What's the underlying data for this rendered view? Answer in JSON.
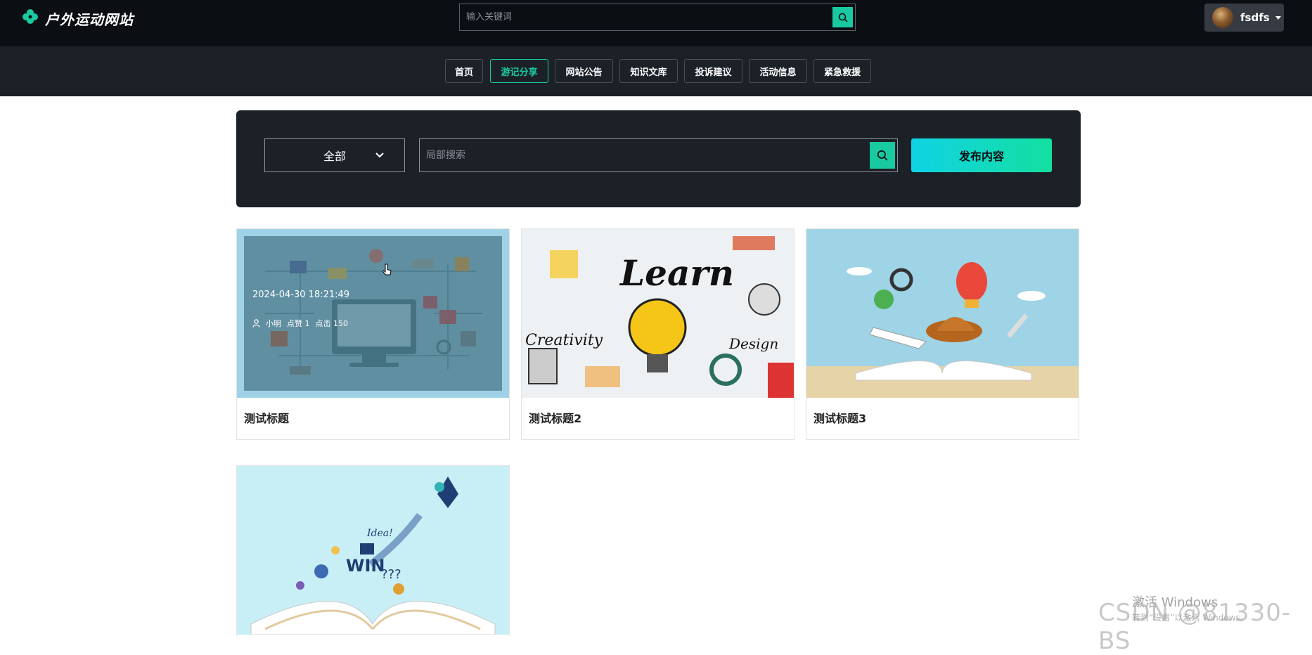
{
  "header": {
    "site_title": "户外运动网站",
    "search_placeholder": "输入关键词",
    "username": "fsdfs"
  },
  "nav": {
    "items": [
      {
        "label": "首页",
        "active": false
      },
      {
        "label": "游记分享",
        "active": true
      },
      {
        "label": "网站公告",
        "active": false
      },
      {
        "label": "知识文库",
        "active": false
      },
      {
        "label": "投诉建议",
        "active": false
      },
      {
        "label": "活动信息",
        "active": false
      },
      {
        "label": "紧急救援",
        "active": false
      }
    ]
  },
  "filter": {
    "category_selected": "全部",
    "search_placeholder": "局部搜索",
    "publish_label": "发布内容"
  },
  "cards": [
    {
      "title": "测试标题",
      "date": "2024-04-30 18:21:49",
      "author": "小明",
      "likes": "点赞 1",
      "views": "点击 150",
      "image": "network-diagram"
    },
    {
      "title": "测试标题2",
      "image": "learn-collage"
    },
    {
      "title": "测试标题3",
      "image": "open-book-travel"
    },
    {
      "title": "",
      "image": "open-book-rocket"
    }
  ],
  "colors": {
    "accent": "#19c9a0",
    "topbar": "#0b0e13",
    "panel": "#1c2128"
  },
  "watermark": {
    "line1": "激活 Windows",
    "line2": "CSDN @81330-BS",
    "line3": "转到“设置”以激活 Windows。"
  }
}
